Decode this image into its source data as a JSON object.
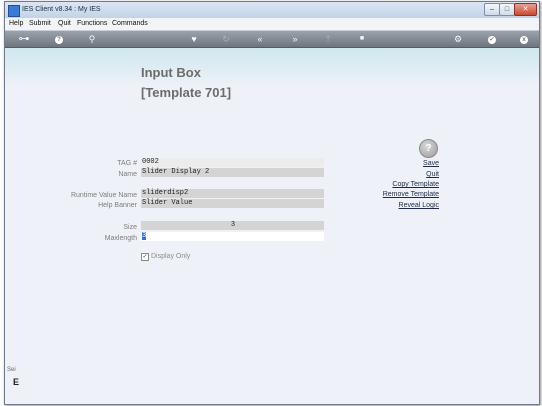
{
  "window": {
    "title": "IES Client v8.34 : My IES",
    "min_symbol": "–",
    "max_symbol": "□",
    "close_symbol": "✕"
  },
  "menu": [
    "Help",
    "Submit",
    "Quit",
    "Functions",
    "Commands"
  ],
  "toolbar": {
    "icons": [
      "key-icon",
      "info-icon",
      "search-icon",
      "heart-icon",
      "refresh-icon",
      "rewind-icon",
      "fast-forward-icon",
      "upload-icon",
      "stop-icon",
      "settings-icon",
      "check-icon",
      "close-icon"
    ],
    "glyphs": {
      "key": "⊶",
      "info": "?",
      "search": "⚲",
      "heart": "♥",
      "refresh": "↻",
      "rewind": "«",
      "forward": "»",
      "upload": "⇡",
      "stop": "■",
      "settings": "⚙",
      "check": "✓",
      "close": "x"
    }
  },
  "page": {
    "title": "Input Box",
    "subtitle": "[Template 701]"
  },
  "form": {
    "tag_label": "TAG #",
    "tag_value": "0002",
    "name_label": "Name",
    "name_value": "Slider Display 2",
    "runtime_label": "Runtime Value Name",
    "runtime_value": "sliderdisp2",
    "help_label": "Help Banner",
    "help_value": "Slider Value",
    "size_label": "Size",
    "size_value": "3",
    "maxlength_label": "Maxlength",
    "maxlength_value": "3",
    "display_only_label": "Display Only",
    "display_only_checked": true,
    "check_glyph": "✓"
  },
  "actions": {
    "help_glyph": "?",
    "save": "Save",
    "quit": "Quit",
    "copy_template": "Copy Template",
    "remove_template": "Remove Template",
    "reveal_logic": "Reveal Logic"
  },
  "side_fragment": {
    "top": "Sei",
    "bottom": "E"
  },
  "colors": {
    "toolbar": "#7f868d",
    "content_bg": "#eef2f8",
    "header_gradient": "#cfe8ee",
    "field_gray": "#d4d4d4",
    "link": "#1f2a44",
    "cursor": "#2f6fd6"
  }
}
